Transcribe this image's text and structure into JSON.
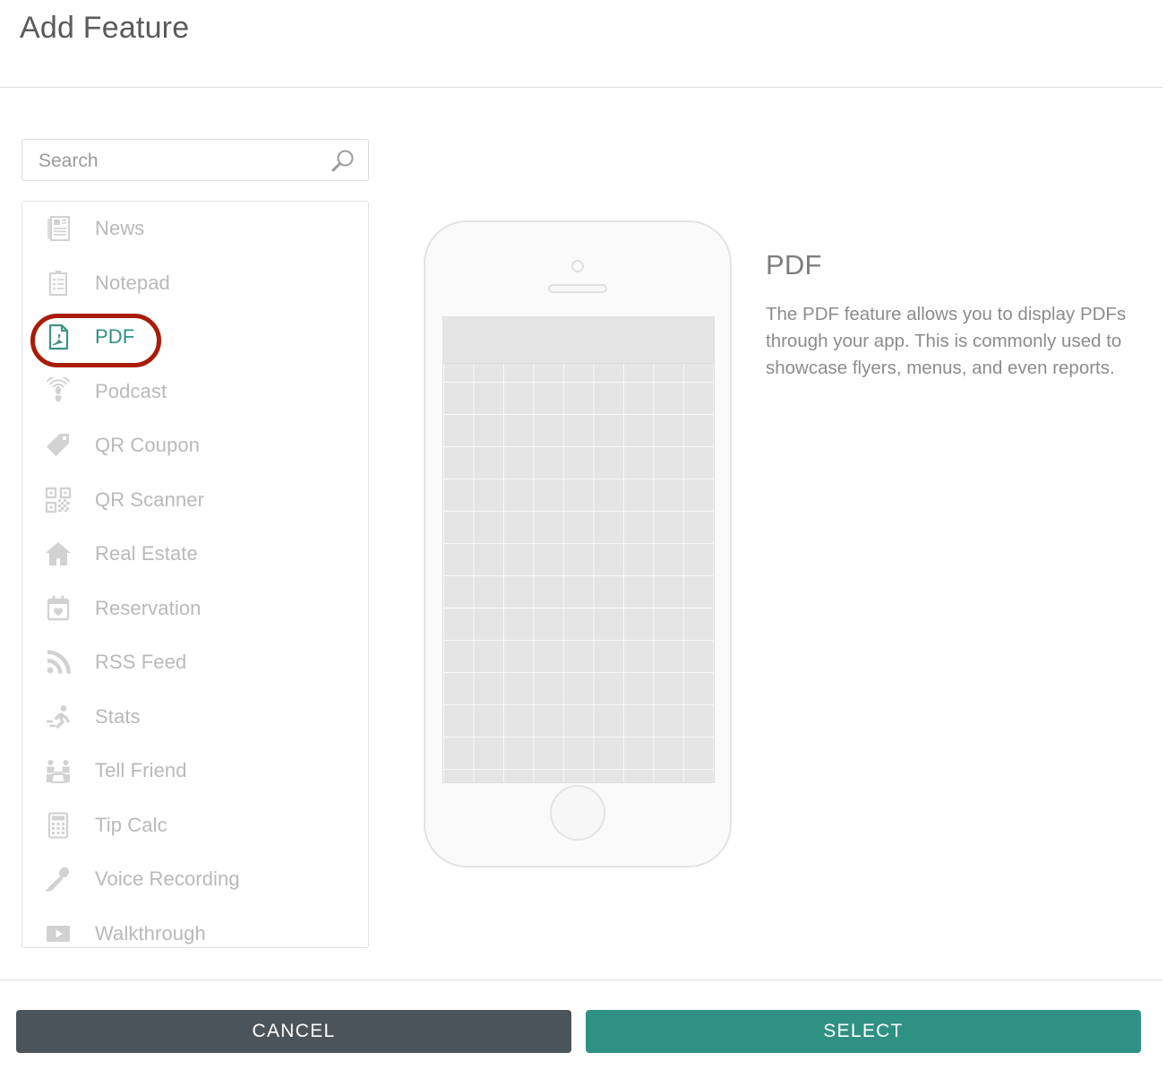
{
  "dialog": {
    "title": "Add Feature"
  },
  "search": {
    "placeholder": "Search",
    "value": "",
    "icon": "search-icon"
  },
  "feature_list": {
    "items": [
      {
        "label": "News",
        "icon": "newspaper-icon",
        "selected": false
      },
      {
        "label": "Notepad",
        "icon": "clipboard-icon",
        "selected": false
      },
      {
        "label": "PDF",
        "icon": "pdf-document-icon",
        "selected": true
      },
      {
        "label": "Podcast",
        "icon": "podcast-icon",
        "selected": false
      },
      {
        "label": "QR Coupon",
        "icon": "tag-icon",
        "selected": false
      },
      {
        "label": "QR Scanner",
        "icon": "qr-code-icon",
        "selected": false
      },
      {
        "label": "Real Estate",
        "icon": "house-icon",
        "selected": false
      },
      {
        "label": "Reservation",
        "icon": "calendar-heart-icon",
        "selected": false
      },
      {
        "label": "RSS Feed",
        "icon": "rss-icon",
        "selected": false
      },
      {
        "label": "Stats",
        "icon": "runner-icon",
        "selected": false
      },
      {
        "label": "Tell Friend",
        "icon": "two-people-table-icon",
        "selected": false
      },
      {
        "label": "Tip Calc",
        "icon": "calculator-icon",
        "selected": false
      },
      {
        "label": "Voice Recording",
        "icon": "microphone-icon",
        "selected": false
      },
      {
        "label": "Walkthrough",
        "icon": "video-play-icon",
        "selected": false
      }
    ]
  },
  "preview": {
    "device": "phone-mockup"
  },
  "detail": {
    "title": "PDF",
    "description": "The PDF feature allows you to display PDFs through your app. This is commonly used to showcase flyers, menus, and even reports."
  },
  "footer": {
    "cancel_label": "CANCEL",
    "select_label": "SELECT"
  },
  "colors": {
    "accent_teal": "#2f9184",
    "cancel_gray": "#4c545b",
    "highlight_red": "#a81c09",
    "muted_text": "#b9b9b9"
  }
}
